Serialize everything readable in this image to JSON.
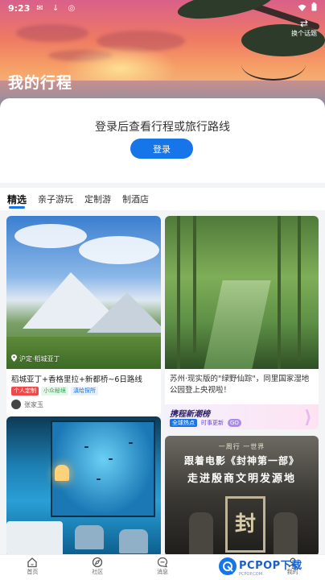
{
  "status_bar": {
    "time": "9:23",
    "left_icons": [
      "mail-icon",
      "download-icon",
      "notification-icon"
    ],
    "right_icons": [
      "wifi-icon",
      "battery-icon"
    ]
  },
  "header": {
    "title": "我的行程",
    "photo_toggle_label": "换个话题"
  },
  "login": {
    "prompt": "登录后查看行程或旅行路线",
    "button_label": "登录"
  },
  "tabs": [
    {
      "label": "精选",
      "active": true
    },
    {
      "label": "亲子游玩",
      "active": false
    },
    {
      "label": "定制游",
      "active": false
    },
    {
      "label": "制酒店",
      "active": false
    }
  ],
  "cards": [
    {
      "location": "沪定·稻城亚丁",
      "title": "稻城亚丁+香格里拉+新都桥~6日路线",
      "tags": [
        "个人定制",
        "小众秘境",
        "滇给探所"
      ],
      "author": "张家玉"
    },
    {
      "title": "苏州·现实版的\"绿野仙踪\"，同里国家湿地公园登上央视啦！",
      "promo_title": "携程新潮榜",
      "promo_chips": [
        "全球热点",
        "时事更新",
        "GO"
      ]
    },
    {
      "title": ""
    },
    {
      "poster_line1": "一周行 一世界",
      "poster_line2": "跟着电影《封神第一部》",
      "poster_line3": "走进殷商文明发源地",
      "poster_seal": "封"
    }
  ],
  "bottom_nav": [
    {
      "label": "首页",
      "icon": "home-icon",
      "active": false
    },
    {
      "label": "社区",
      "icon": "compass-icon",
      "active": false
    },
    {
      "label": "消息",
      "icon": "message-icon",
      "active": false
    },
    {
      "label": "行程",
      "icon": "itinerary-icon",
      "active": true
    },
    {
      "label": "我的",
      "icon": "user-icon",
      "active": false
    }
  ],
  "watermark": {
    "text": "PCPOP下载",
    "sub": "PCPOP.COM"
  },
  "colors": {
    "accent": "#1675e8",
    "tag_red": "#f04848"
  }
}
